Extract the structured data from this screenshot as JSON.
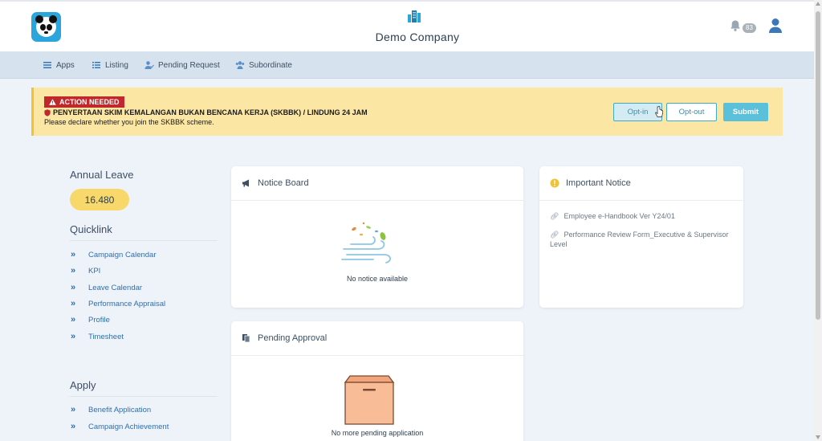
{
  "header": {
    "company_name": "Demo Company",
    "notification_count": "83",
    "icons": {
      "logo": "panda-logo",
      "company": "buildings-icon",
      "bell": "bell-icon",
      "user": "user-icon"
    }
  },
  "nav": {
    "items": [
      {
        "label": "Apps",
        "icon": "menu-icon"
      },
      {
        "label": "Listing",
        "icon": "list-icon"
      },
      {
        "label": "Pending Request",
        "icon": "user-check-icon"
      },
      {
        "label": "Subordinate",
        "icon": "users-icon"
      }
    ]
  },
  "alert": {
    "tag": "ACTION NEEDED",
    "title": "PENYERTAAN SKIM KEMALANGAN BUKAN BENCANA KERJA (SKBBK) / LINDUNG 24 JAM",
    "description": "Please declare whether you join the SKBBK scheme.",
    "opt_in_label": "Opt-in",
    "opt_out_label": "Opt-out",
    "submit_label": "Submit"
  },
  "annual_leave": {
    "heading": "Annual Leave",
    "value": "16.480"
  },
  "quicklink": {
    "heading": "Quicklink",
    "items": [
      {
        "label": "Campaign Calendar"
      },
      {
        "label": "KPI"
      },
      {
        "label": "Leave Calendar"
      },
      {
        "label": "Performance Appraisal"
      },
      {
        "label": "Profile"
      },
      {
        "label": "Timesheet"
      }
    ]
  },
  "apply": {
    "heading": "Apply",
    "items": [
      {
        "label": "Benefit Application"
      },
      {
        "label": "Campaign Achievement"
      }
    ]
  },
  "notice_board": {
    "title": "Notice Board",
    "empty_text": "No notice available"
  },
  "important_notice": {
    "title": "Important Notice",
    "items": [
      {
        "label": "Employee e-Handbook Ver Y24/01"
      },
      {
        "label": "Performance Review Form_Executive & Supervisor Level"
      }
    ]
  },
  "pending_approval": {
    "title": "Pending Approval",
    "empty_text": "No more pending application"
  },
  "colors": {
    "accent": "#3fa9c9",
    "alert_bg": "#fbe6a4",
    "alert_tag": "#c0282c",
    "link": "#2d6fb0",
    "leave_pill": "#f9d86b"
  }
}
